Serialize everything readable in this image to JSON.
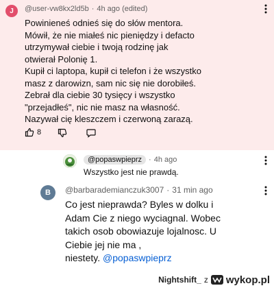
{
  "comment1": {
    "avatar_letter": "J",
    "author": "@user-vw8kx2ld5b",
    "time": "4h ago (edited)",
    "lines": [
      "Powinieneś odnieś się do słów mentora.",
      "Mówił, że nie miałeś nic pieniędzy i defacto",
      "utrzymywał ciebie i twoją rodzinę jak",
      "otwierał Polonię 1.",
      "Kupił ci laptopa, kupił ci telefon i że wszystko",
      "masz z darowizn, sam nic się nie dorobiłeś.",
      "Zebrał dla ciebie 30 tysięcy i wszystko",
      "\"przejadłeś\", nic nie masz na własność.",
      "Nazywał cię kleszczem i czerwoną zarazą."
    ],
    "likes": "8"
  },
  "reply1": {
    "author": "@popaswpieprz",
    "time": "4h ago",
    "text": "Wszystko jest nie prawdą."
  },
  "comment2": {
    "avatar_letter": "B",
    "author": "@barbarademianczuk3007",
    "time": "31 min ago",
    "lines": [
      "Co jest nieprawda? Byles w dolku i",
      "Adam Cie z niego wyciagnal. Wobec",
      "takich osob obowiazuje lojalnosc. U",
      "Ciebie jej nie ma ,"
    ],
    "last_line_prefix": "niestety. ",
    "mention": "@popaswpieprz"
  },
  "watermark": {
    "user": "Nightshift_",
    "separator": "z",
    "site": "wykop.pl"
  },
  "colors": {
    "highlight_bg": "#fdebeb",
    "avatar_j": "#e24e6b",
    "avatar_b": "#5f7b95",
    "mention": "#065fd4"
  }
}
